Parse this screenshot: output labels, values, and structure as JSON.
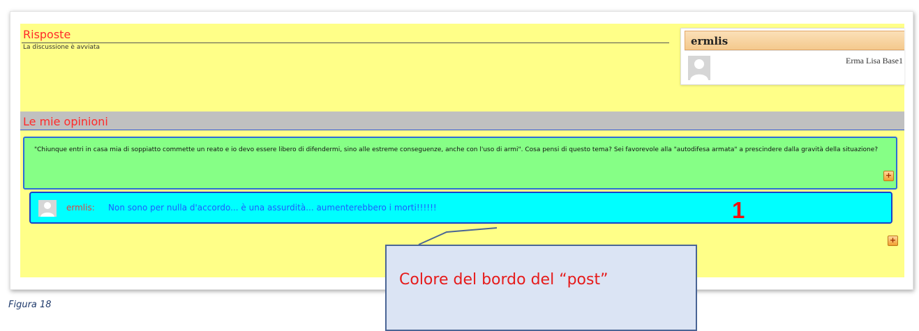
{
  "risposte": {
    "title": "Risposte",
    "subtitle": "La discussione è avviata"
  },
  "user_card": {
    "username": "ermlis",
    "full_name": "Erma Lisa Base1",
    "avatar_icon": "user-silhouette-icon"
  },
  "opinioni": {
    "title": "Le mie opinioni",
    "question": "\"Chiunque entri in casa mia di soppiatto commette un reato e io devo essere libero di difendermi, sino alle estreme conseguenze, anche con l'uso di armi\". Cosa pensi di questo tema? Sei favorevole alla \"autodifesa armata\" a prescindere dalla gravità della situazione?",
    "plus_symbol": "+"
  },
  "post": {
    "author": "ermlis:",
    "text": "Non sono per nulla d'accordo... è una assurdità... aumenterebbero i morti!!!!!!",
    "border_color": "#1a40c8",
    "background_color": "#00ffff"
  },
  "annotation": {
    "marker": "1",
    "callout": "Colore del bordo del “post”"
  },
  "caption": "Figura 18",
  "colors": {
    "panel_yellow": "#ffff88",
    "title_red": "#ff2a2a",
    "question_green": "#86ff86"
  }
}
